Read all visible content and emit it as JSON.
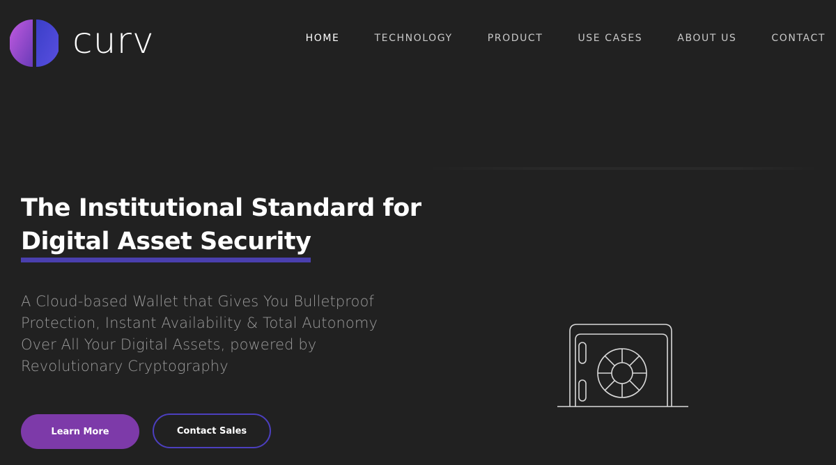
{
  "brand": {
    "name": "curv",
    "accent_purple": "#7d3aa9",
    "accent_indigo": "#4a3fae"
  },
  "nav": {
    "items": [
      {
        "label": "HOME",
        "active": true
      },
      {
        "label": "TECHNOLOGY",
        "active": false
      },
      {
        "label": "PRODUCT",
        "active": false
      },
      {
        "label": "USE CASES",
        "active": false
      },
      {
        "label": "ABOUT US",
        "active": false
      },
      {
        "label": "CONTACT",
        "active": false
      }
    ]
  },
  "hero": {
    "title_line1": "The Institutional Standard for",
    "title_line2": "Digital Asset Security",
    "subtitle": "A Cloud-based Wallet that Gives You Bulletproof Protection, Instant Availability & Total Autonomy Over All Your Digital Assets, powered by Revolutionary Cryptography",
    "primary_button": "Learn More",
    "secondary_button": "Contact Sales",
    "illustration": "vault-safe-icon"
  }
}
